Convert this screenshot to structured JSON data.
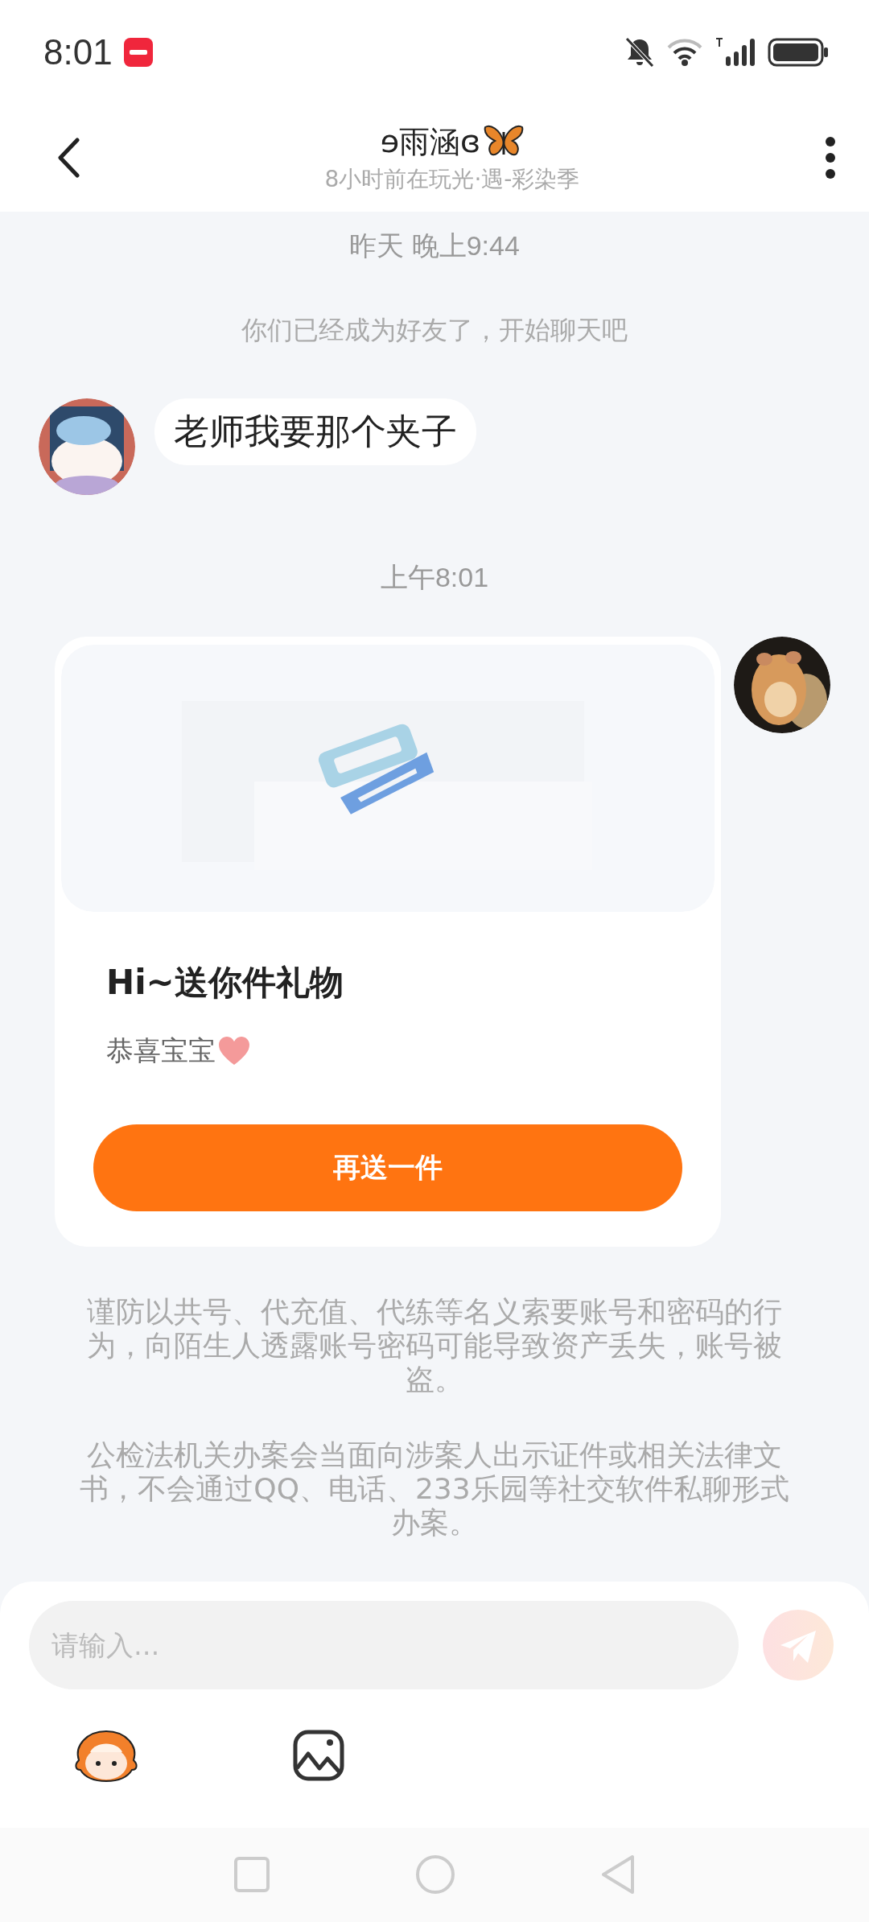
{
  "status_bar": {
    "time": "8:01"
  },
  "header": {
    "title": "ɘ雨涵ɞ",
    "subtitle": "8小时前在玩光·遇-彩染季"
  },
  "messages": [
    {
      "kind": "timestamp",
      "text": "昨天 晚上9:44"
    },
    {
      "kind": "system",
      "text": "你们已经成为好友了，开始聊天吧"
    },
    {
      "kind": "text",
      "outgoing": false,
      "text": "老师我要那个夹子"
    },
    {
      "kind": "timestamp",
      "text": "上午8:01"
    },
    {
      "kind": "gift",
      "outgoing": true,
      "title": "Hi~送你件礼物",
      "note": "恭喜宝宝",
      "button": "再送一件"
    }
  ],
  "notices": [
    "谨防以共号、代充值、代练等名义索要账号和密码的行为，向陌生人透露账号密码可能导致资产丢失，账号被盗。",
    "公检法机关办案会当面向涉案人出示证件或相关法律文书，不会通过QQ、电话、233乐园等社交软件私聊形式办案。"
  ],
  "input": {
    "placeholder": "请输入..."
  }
}
